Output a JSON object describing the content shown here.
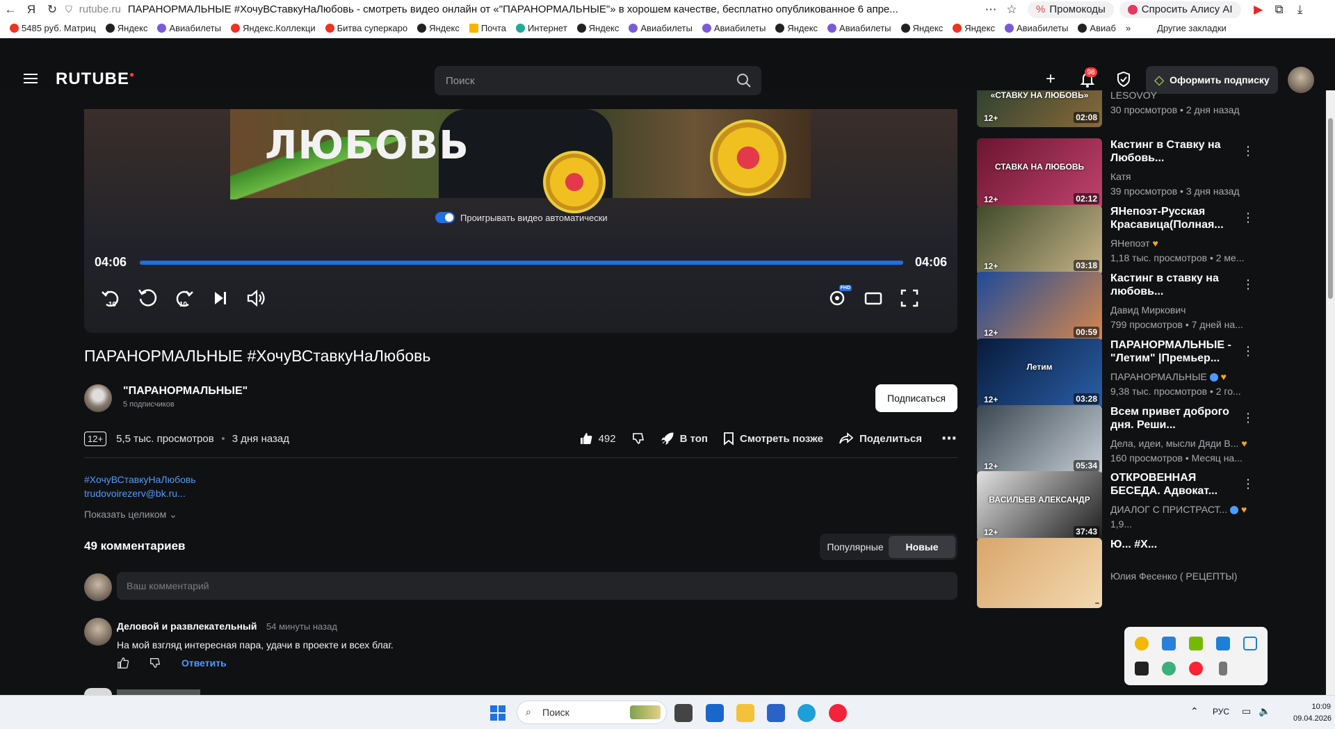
{
  "browser": {
    "domain": "rutube.ru",
    "tab_title": "ПАРАНОРМАЛЬНЫЕ #ХочуВСтавкуНаЛюбовь - смотреть видео онлайн от «\"ПАРАНОРМАЛЬНЫЕ\"» в хорошем качестве, бесплатно опубликованное 6 апре...",
    "promo_label": "Промокоды",
    "alice_label": "Спросить Алису AI",
    "bookmarks": [
      "5485 руб. Матриц",
      "Яндекс",
      "Авиабилеты",
      "Яндекс.Коллекци",
      "Битва суперкаро",
      "Яндекс",
      "Почта",
      "Интернет",
      "Яндекс",
      "Авиабилеты",
      "Авиабилеты",
      "Яндекс",
      "Авиабилеты",
      "Яндекс",
      "Яндекс",
      "Авиабилеты",
      "Авиаб"
    ],
    "other_bookmarks": "Другие закладки"
  },
  "header": {
    "logo": "RUTUBE",
    "search_placeholder": "Поиск",
    "notifications_count": "98",
    "subscribe_offer": "Оформить подписку"
  },
  "player": {
    "thumb_text": "ЛЮБОВЬ",
    "autoplay_label": "Проигрывать видео автоматически",
    "time_current": "04:06",
    "time_total": "04:06",
    "progress": 1.0,
    "quality_badge": "FHD"
  },
  "video": {
    "title": "ПАРАНОРМАЛЬНЫЕ #ХочуВСтавкуНаЛюбовь",
    "channel": "\"ПАРАНОРМАЛЬНЫЕ\"",
    "subscribers": "5 подписчиков",
    "subscribe_button": "Подписаться",
    "age": "12+",
    "views": "5,5 тыс. просмотров",
    "published": "3 дня назад",
    "likes": "492",
    "to_top": "В топ",
    "watch_later": "Смотреть позже",
    "share": "Поделиться",
    "description_tag": "#ХочуВСтавкуНаЛюбовь",
    "description_mail": "trudovoirezerv@bk.ru...",
    "show_more": "Показать целиком"
  },
  "comments": {
    "count_label": "49 комментариев",
    "sort_popular": "Популярные",
    "sort_new": "Новые",
    "input_placeholder": "Ваш комментарий",
    "items": [
      {
        "author": "Деловой и развлекательный",
        "time": "54 минуты назад",
        "text": "На мой взгляд интересная пара, удачи в проекте и всех благ.",
        "reply": "Ответить"
      }
    ]
  },
  "recommendations": [
    {
      "title": "...",
      "channel": "LESOVOY",
      "stats": "30 просмотров • 2 дня назад",
      "age": "12+",
      "duration": "02:08",
      "thumb_caption": "НАРОДНЫЙ КАСТИНГ «СТАВКУ НА ЛЮБОВЬ»",
      "colors": [
        "#1d3a2f",
        "#8a6a3a"
      ]
    },
    {
      "title": "Кастинг в Ставку на Любовь...",
      "channel": "Катя",
      "stats": "39 просмотров • 3 дня назад",
      "age": "12+",
      "duration": "02:12",
      "thumb_caption": "СТАВКА НА ЛЮБОВЬ",
      "colors": [
        "#6a1530",
        "#c2436e"
      ]
    },
    {
      "title": "ЯНепоэт-Русская Красавица(Полная...",
      "channel": "ЯНепоэт",
      "stats": "1,18 тыс. просмотров • 2 ме...",
      "age": "12+",
      "duration": "03:18",
      "thumb_caption": "",
      "colors": [
        "#3f4a2a",
        "#c9b58a"
      ]
    },
    {
      "title": "Кастинг в ставку на любовь...",
      "channel": "Давид Миркович",
      "stats": "799 просмотров • 7 дней на...",
      "age": "12+",
      "duration": "00:59",
      "thumb_caption": "",
      "colors": [
        "#1e4a9a",
        "#d9884a"
      ]
    },
    {
      "title": "ПАРАНОРМАЛЬНЫЕ - \"Летим\" |Премьер...",
      "channel": "ПАРАНОРМАЛЬНЫЕ",
      "stats": "9,38 тыс. просмотров • 2 го...",
      "age": "12+",
      "duration": "03:28",
      "thumb_caption": "Летим",
      "colors": [
        "#071a3a",
        "#2b5fa8"
      ]
    },
    {
      "title": "Всем привет доброго дня. Реши...",
      "channel": "Дела, идеи, мысли Дяди В...",
      "stats": "160 просмотров • Месяц на...",
      "age": "12+",
      "duration": "05:34",
      "thumb_caption": "",
      "colors": [
        "#3a4650",
        "#c8d0d8"
      ]
    },
    {
      "title": "ОТКРОВЕННАЯ БЕСЕДА. Адвокат...",
      "channel": "ДИАЛОГ С ПРИСТРАСТ...",
      "stats": "1,9...",
      "age": "12+",
      "duration": "37:43",
      "thumb_caption": "ВАСИЛЬЕВ АЛЕКСАНДР",
      "colors": [
        "#e0e0e0",
        "#1a1a1a"
      ]
    },
    {
      "title": "Ю... #Х...",
      "channel": "Юлия Фесенко ( РЕЦЕПТЫ)",
      "stats": "",
      "age": "",
      "duration": "",
      "thumb_caption": "",
      "colors": [
        "#d9a66a",
        "#f3d9b0"
      ]
    }
  ],
  "taskbar": {
    "search_placeholder": "Поиск",
    "lang": "РУС",
    "time": "10:09",
    "date": "09.04.2026"
  }
}
